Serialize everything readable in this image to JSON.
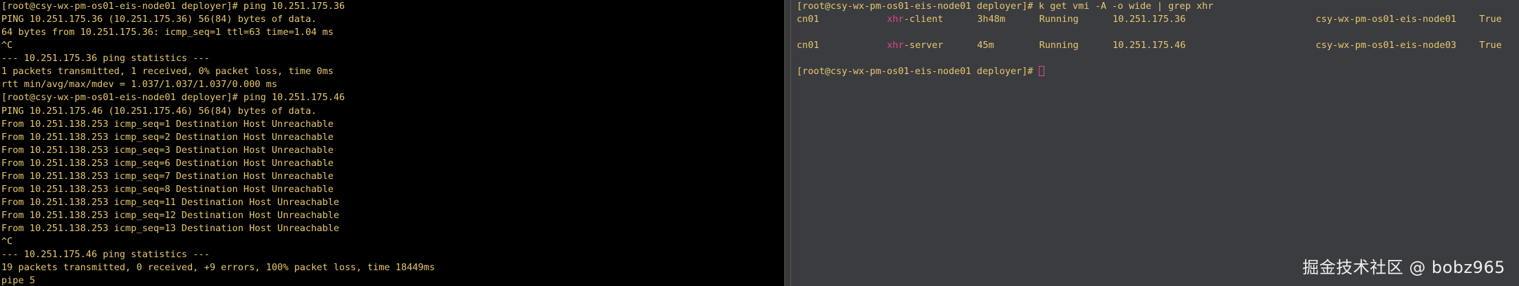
{
  "left_terminal": {
    "lines": [
      "[root@csy-wx-pm-os01-eis-node01 deployer]# ping 10.251.175.36",
      "PING 10.251.175.36 (10.251.175.36) 56(84) bytes of data.",
      "64 bytes from 10.251.175.36: icmp_seq=1 ttl=63 time=1.04 ms",
      "^C",
      "--- 10.251.175.36 ping statistics ---",
      "1 packets transmitted, 1 received, 0% packet loss, time 0ms",
      "rtt min/avg/max/mdev = 1.037/1.037/1.037/0.000 ms",
      "[root@csy-wx-pm-os01-eis-node01 deployer]# ping 10.251.175.46",
      "PING 10.251.175.46 (10.251.175.46) 56(84) bytes of data.",
      "From 10.251.138.253 icmp_seq=1 Destination Host Unreachable",
      "From 10.251.138.253 icmp_seq=2 Destination Host Unreachable",
      "From 10.251.138.253 icmp_seq=3 Destination Host Unreachable",
      "From 10.251.138.253 icmp_seq=6 Destination Host Unreachable",
      "From 10.251.138.253 icmp_seq=7 Destination Host Unreachable",
      "From 10.251.138.253 icmp_seq=8 Destination Host Unreachable",
      "From 10.251.138.253 icmp_seq=11 Destination Host Unreachable",
      "From 10.251.138.253 icmp_seq=12 Destination Host Unreachable",
      "From 10.251.138.253 icmp_seq=13 Destination Host Unreachable",
      "^C",
      "--- 10.251.175.46 ping statistics ---",
      "19 packets transmitted, 0 received, +9 errors, 100% packet loss, time 18449ms",
      "pipe 5"
    ]
  },
  "right_terminal": {
    "command_line": "[root@csy-wx-pm-os01-eis-node01 deployer]# k get vmi -A -o wide | grep xhr",
    "rows": [
      {
        "namespace": "cn01",
        "name_highlight": "xhr",
        "name_rest": "-client",
        "age": "3h48m",
        "phase": "Running",
        "ip": "10.251.175.36",
        "node": "csy-wx-pm-os01-eis-node01",
        "ready": "True",
        "live": "True"
      },
      {
        "namespace": "cn01",
        "name_highlight": "xhr",
        "name_rest": "-server",
        "age": "45m",
        "phase": "Running",
        "ip": "10.251.175.46",
        "node": "csy-wx-pm-os01-eis-node03",
        "ready": "True",
        "live": "True"
      }
    ],
    "prompt": "[root@csy-wx-pm-os01-eis-node01 deployer]# "
  },
  "watermark": "掘金技术社区 @ bobz965",
  "colors": {
    "text": "#e6c86e",
    "highlight": "#e0458f",
    "left_bg": "#000000",
    "right_bg": "#3b3c40"
  }
}
